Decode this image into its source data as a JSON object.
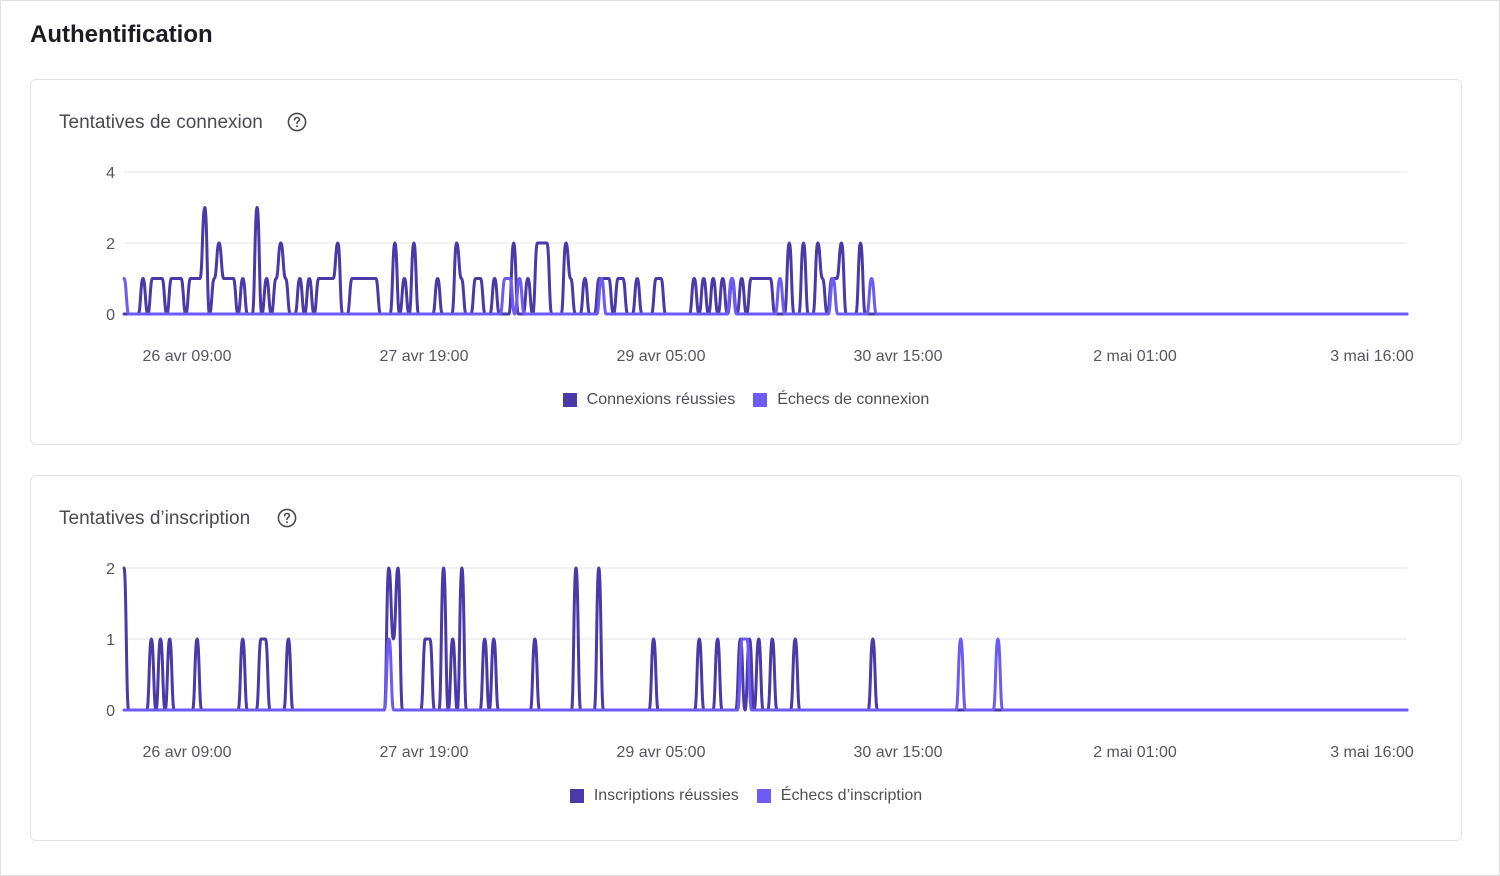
{
  "section": {
    "title": "Authentification"
  },
  "icons": {
    "help": "help-circle-icon"
  },
  "colors": {
    "success": "#4a3aa8",
    "failure": "#6c5cf5",
    "grid": "#e8e8ec"
  },
  "charts": [
    {
      "title": "Tentatives de connexion",
      "legend": [
        "Connexions réussies",
        "Échecs de connexion"
      ],
      "x_tick_labels": [
        "26 avr 09:00",
        "27 avr 19:00",
        "29 avr 05:00",
        "30 avr 15:00",
        "2 mai 01:00",
        "3 mai 16:00"
      ],
      "y_tick_labels": [
        "0",
        "2",
        "4"
      ]
    },
    {
      "title": "Tentatives d’inscription",
      "legend": [
        "Inscriptions réussies",
        "Échecs d’inscription"
      ],
      "x_tick_labels": [
        "26 avr 09:00",
        "27 avr 19:00",
        "29 avr 05:00",
        "30 avr 15:00",
        "2 mai 01:00",
        "3 mai 16:00"
      ],
      "y_tick_labels": [
        "0",
        "1",
        "2"
      ]
    }
  ],
  "chart_data": [
    {
      "type": "line",
      "title": "Tentatives de connexion",
      "xlabel": "",
      "ylabel": "",
      "x_ticks": [
        "26 avr 09:00",
        "27 avr 19:00",
        "29 avr 05:00",
        "30 avr 15:00",
        "2 mai 01:00",
        "3 mai 16:00"
      ],
      "ylim": [
        0,
        4
      ],
      "grid": true,
      "legend_position": "bottom",
      "series": [
        {
          "name": "Connexions réussies",
          "color": "#4a3aa8",
          "values": [
            0,
            0,
            0,
            0,
            1,
            0,
            1,
            1,
            1,
            0,
            1,
            1,
            1,
            0,
            1,
            1,
            1,
            3,
            0,
            1,
            2,
            1,
            1,
            1,
            0,
            1,
            0,
            0,
            3,
            0,
            1,
            0,
            1,
            2,
            1,
            0,
            0,
            1,
            0,
            1,
            0,
            1,
            1,
            1,
            1,
            2,
            0,
            0,
            1,
            1,
            1,
            1,
            1,
            1,
            0,
            0,
            0,
            2,
            0,
            1,
            0,
            2,
            0,
            0,
            0,
            0,
            1,
            0,
            0,
            0,
            2,
            1,
            0,
            0,
            1,
            1,
            0,
            0,
            1,
            0,
            0,
            0,
            2,
            0,
            0,
            1,
            0,
            2,
            2,
            2,
            0,
            0,
            0,
            2,
            1,
            0,
            0,
            1,
            0,
            0,
            1,
            1,
            1,
            0,
            1,
            1,
            0,
            0,
            1,
            0,
            0,
            0,
            1,
            1,
            0,
            0,
            0,
            0,
            0,
            0,
            1,
            0,
            1,
            0,
            1,
            0,
            1,
            0,
            1,
            0,
            1,
            0,
            1,
            1,
            1,
            1,
            1,
            0,
            0,
            0,
            2,
            0,
            0,
            2,
            0,
            0,
            2,
            1,
            0,
            1,
            1,
            2,
            0,
            0,
            0,
            2,
            0,
            0,
            0,
            0,
            0,
            0,
            0,
            0,
            0,
            0,
            0,
            0,
            0,
            0,
            0,
            0,
            0,
            0,
            0,
            0,
            0,
            0,
            0,
            0,
            0,
            0,
            0,
            0,
            0,
            0,
            0,
            0,
            0,
            0,
            0,
            0,
            0,
            0,
            0,
            0,
            0,
            0,
            0,
            0,
            0,
            0,
            0,
            0,
            0,
            0,
            0,
            0,
            0,
            0,
            0,
            0,
            0,
            0,
            0,
            0,
            0,
            0,
            0,
            0,
            0,
            0,
            0,
            0,
            0,
            0,
            0,
            0,
            0,
            0,
            0,
            0,
            0,
            0,
            0,
            0,
            0,
            0,
            0,
            0,
            0,
            0,
            0,
            0,
            0,
            0,
            0,
            0,
            0,
            0,
            0,
            0,
            0,
            0,
            0,
            0,
            0,
            0,
            0,
            0,
            0,
            0,
            0,
            0,
            0,
            0,
            0,
            0,
            0,
            0,
            0
          ]
        },
        {
          "name": "Échecs de connexion",
          "color": "#6c5cf5",
          "values": [
            1,
            0,
            0,
            0,
            0,
            0,
            0,
            0,
            0,
            0,
            0,
            0,
            0,
            0,
            0,
            0,
            0,
            0,
            0,
            0,
            0,
            0,
            0,
            0,
            0,
            0,
            0,
            0,
            0,
            0,
            0,
            0,
            0,
            0,
            0,
            0,
            0,
            0,
            0,
            0,
            0,
            0,
            0,
            0,
            0,
            0,
            0,
            0,
            0,
            0,
            0,
            0,
            0,
            0,
            0,
            0,
            0,
            0,
            0,
            0,
            0,
            0,
            0,
            0,
            0,
            0,
            0,
            0,
            0,
            0,
            0,
            0,
            0,
            0,
            0,
            0,
            0,
            0,
            0,
            1,
            1,
            0,
            1,
            0,
            0,
            0,
            0,
            0,
            0,
            0,
            0,
            0,
            0,
            0,
            0,
            0,
            0,
            0,
            0,
            1,
            0,
            0,
            0,
            0,
            0,
            0,
            0,
            0,
            0,
            0,
            0,
            0,
            0,
            0,
            0,
            0,
            0,
            0,
            0,
            0,
            0,
            0,
            0,
            0,
            0,
            0,
            1,
            0,
            0,
            0,
            0,
            0,
            0,
            0,
            0,
            0,
            1,
            0,
            0,
            0,
            0,
            0,
            0,
            0,
            0,
            0,
            0,
            1,
            0,
            0,
            0,
            0,
            0,
            0,
            0,
            1,
            0,
            0,
            0,
            0,
            0,
            0,
            0,
            0,
            0,
            0,
            0,
            0,
            0,
            0,
            0,
            0,
            0,
            0,
            0,
            0,
            0,
            0,
            0,
            0,
            0,
            0,
            0,
            0,
            0,
            0,
            0,
            0,
            0,
            0,
            0,
            0,
            0,
            0,
            0,
            0,
            0,
            0,
            0,
            0,
            0,
            0,
            0,
            0,
            0,
            0,
            0,
            0,
            0,
            0,
            0,
            0,
            0,
            0,
            0,
            0,
            0,
            0,
            0,
            0,
            0,
            0,
            0,
            0,
            0,
            0,
            0,
            0,
            0,
            0,
            0,
            0,
            0,
            0,
            0,
            0,
            0,
            0,
            0,
            0,
            0,
            0,
            0,
            0,
            0,
            0,
            0,
            0,
            0,
            0,
            0,
            0,
            0,
            0,
            0,
            0,
            0,
            0,
            0,
            0,
            0,
            0,
            0,
            0,
            0,
            0,
            0
          ]
        }
      ]
    },
    {
      "type": "line",
      "title": "Tentatives d’inscription",
      "xlabel": "",
      "ylabel": "",
      "x_ticks": [
        "26 avr 09:00",
        "27 avr 19:00",
        "29 avr 05:00",
        "30 avr 15:00",
        "2 mai 01:00",
        "3 mai 16:00"
      ],
      "ylim": [
        0,
        2
      ],
      "grid": true,
      "legend_position": "bottom",
      "series": [
        {
          "name": "Inscriptions réussies",
          "color": "#4a3aa8",
          "values": [
            2,
            0,
            0,
            0,
            0,
            0,
            1,
            0,
            1,
            0,
            1,
            0,
            0,
            0,
            0,
            0,
            1,
            0,
            0,
            0,
            0,
            0,
            0,
            0,
            0,
            0,
            1,
            0,
            0,
            0,
            1,
            1,
            0,
            0,
            0,
            0,
            1,
            0,
            0,
            0,
            0,
            0,
            0,
            0,
            0,
            0,
            0,
            0,
            0,
            0,
            0,
            0,
            0,
            0,
            0,
            0,
            0,
            0,
            2,
            1,
            2,
            0,
            0,
            0,
            0,
            0,
            1,
            1,
            0,
            0,
            2,
            0,
            1,
            0,
            2,
            0,
            0,
            0,
            0,
            1,
            0,
            1,
            0,
            0,
            0,
            0,
            0,
            0,
            0,
            0,
            1,
            0,
            0,
            0,
            0,
            0,
            0,
            0,
            0,
            2,
            0,
            0,
            0,
            0,
            2,
            0,
            0,
            0,
            0,
            0,
            0,
            0,
            0,
            0,
            0,
            0,
            1,
            0,
            0,
            0,
            0,
            0,
            0,
            0,
            0,
            0,
            1,
            0,
            0,
            0,
            1,
            0,
            0,
            0,
            0,
            1,
            0,
            1,
            0,
            1,
            0,
            0,
            1,
            0,
            0,
            0,
            0,
            1,
            0,
            0,
            0,
            0,
            0,
            0,
            0,
            0,
            0,
            0,
            0,
            0,
            0,
            0,
            0,
            0,
            1,
            0,
            0,
            0,
            0,
            0,
            0,
            0,
            0,
            0,
            0,
            0,
            0,
            0,
            0,
            0,
            0,
            0,
            0,
            0,
            0,
            0,
            0,
            0,
            0,
            0,
            0,
            0,
            0,
            0,
            0,
            0,
            0,
            0,
            0,
            0,
            0,
            0,
            0,
            0,
            0,
            0,
            0,
            0,
            0,
            0,
            0,
            0,
            0,
            0,
            0,
            0,
            0,
            0,
            0,
            0,
            0,
            0,
            0,
            0,
            0,
            0,
            0,
            0,
            0,
            0,
            0,
            0,
            0,
            0,
            0,
            0,
            0,
            0,
            0,
            0,
            0,
            0,
            0,
            0,
            0,
            0,
            0,
            0,
            0,
            0,
            0,
            0,
            0,
            0,
            0,
            0,
            0,
            0,
            0,
            0,
            0,
            0,
            0,
            0,
            0,
            0,
            0,
            0,
            0,
            0,
            0,
            0,
            0,
            0,
            0,
            0,
            0,
            0,
            0,
            0,
            0,
            0
          ]
        },
        {
          "name": "Échecs d’inscription",
          "color": "#6c5cf5",
          "values": [
            0,
            0,
            0,
            0,
            0,
            0,
            0,
            0,
            0,
            0,
            0,
            0,
            0,
            0,
            0,
            0,
            0,
            0,
            0,
            0,
            0,
            0,
            0,
            0,
            0,
            0,
            0,
            0,
            0,
            0,
            0,
            0,
            0,
            0,
            0,
            0,
            0,
            0,
            0,
            0,
            0,
            0,
            0,
            0,
            0,
            0,
            0,
            0,
            0,
            0,
            0,
            0,
            0,
            0,
            0,
            0,
            0,
            1,
            0,
            0,
            0,
            0,
            0,
            0,
            0,
            0,
            0,
            0,
            0,
            0,
            0,
            0,
            0,
            0,
            0,
            0,
            0,
            0,
            0,
            0,
            0,
            0,
            0,
            0,
            0,
            0,
            0,
            0,
            0,
            0,
            0,
            0,
            0,
            0,
            0,
            0,
            0,
            0,
            0,
            0,
            0,
            0,
            0,
            0,
            0,
            0,
            0,
            0,
            0,
            0,
            0,
            0,
            0,
            0,
            0,
            0,
            0,
            0,
            0,
            0,
            0,
            0,
            0,
            0,
            0,
            0,
            0,
            0,
            0,
            0,
            0,
            0,
            0,
            1,
            1,
            0,
            0,
            0,
            0,
            0,
            0,
            0,
            0,
            0,
            0,
            0,
            0,
            0,
            0,
            0,
            0,
            0,
            0,
            0,
            0,
            0,
            0,
            0,
            0,
            0,
            0,
            0,
            0,
            0,
            0,
            0,
            0,
            0,
            0,
            0,
            0,
            0,
            0,
            0,
            0,
            0,
            0,
            0,
            0,
            0,
            1,
            0,
            0,
            0,
            0,
            0,
            0,
            0,
            1,
            0,
            0,
            0,
            0,
            0,
            0,
            0,
            0,
            0,
            0,
            0,
            0,
            0,
            0,
            0,
            0,
            0,
            0,
            0,
            0,
            0,
            0,
            0,
            0,
            0,
            0,
            0,
            0,
            0,
            0,
            0,
            0,
            0,
            0,
            0,
            0,
            0,
            0,
            0,
            0,
            0,
            0,
            0,
            0,
            0,
            0,
            0,
            0,
            0,
            0,
            0,
            0,
            0,
            0,
            0,
            0,
            0,
            0,
            0,
            0,
            0,
            0,
            0,
            0,
            0,
            0,
            0,
            0,
            0,
            0,
            0,
            0,
            0,
            0,
            0,
            0,
            0,
            0,
            0,
            0,
            0,
            0,
            0,
            0,
            0,
            0,
            0,
            0
          ]
        }
      ]
    }
  ]
}
